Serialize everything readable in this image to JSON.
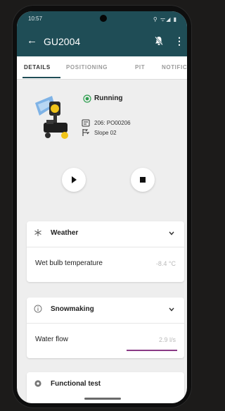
{
  "status_bar": {
    "time": "10:57",
    "system_icons": "⚲ ᯤ◢ ▮"
  },
  "app_bar": {
    "back_icon": "arrow-left-icon",
    "title": "GU2004",
    "more_glyph": "⋮"
  },
  "tabs": [
    {
      "label": "DETAILS",
      "active": true
    },
    {
      "label": "POSITIONING",
      "active": false
    },
    {
      "label": "PIT",
      "active": false
    },
    {
      "label": "NOTIFIC",
      "active": false
    }
  ],
  "unit": {
    "status": "Running",
    "status_color": "#2e9e4f",
    "pipe": "206: PO00206",
    "slope": "Slope 02"
  },
  "controls": {
    "play_icon": "play-icon",
    "stop_icon": "stop-icon"
  },
  "cards": {
    "weather": {
      "title": "Weather",
      "icon": "weather-icon",
      "row_label": "Wet bulb temperature",
      "row_value": "-8.4 °C"
    },
    "snowmaking": {
      "title": "Snowmaking",
      "icon": "info-icon",
      "row_label": "Water flow",
      "row_value": "2.9 l/s"
    },
    "functional_test": {
      "title": "Functional test",
      "icon": "gear-icon"
    }
  },
  "colors": {
    "primary": "#1f4d56",
    "accent": "#8a3b86",
    "running": "#2e9e4f"
  }
}
